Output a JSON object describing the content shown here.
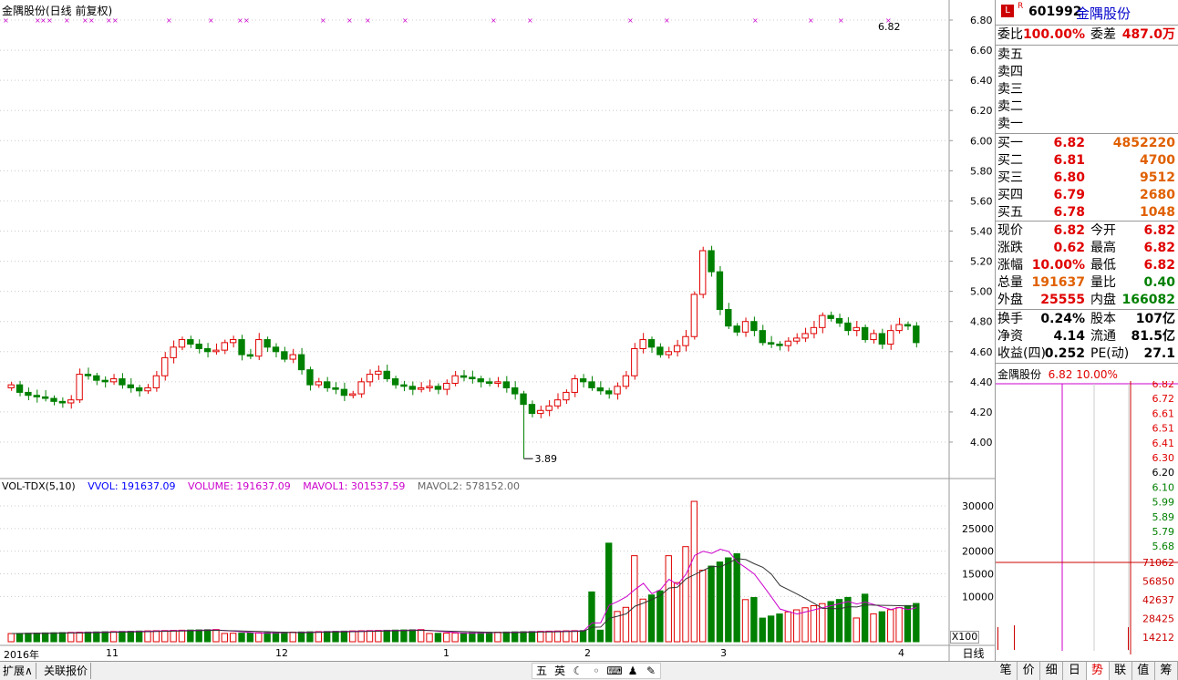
{
  "chart": {
    "title": "金隅股份(日线 前复权)",
    "last_price_label": "6.82",
    "low_label": "3.89",
    "period": "日线",
    "x100": "X100",
    "price_axis": [
      "6.80",
      "6.60",
      "6.40",
      "6.20",
      "6.00",
      "5.80",
      "5.60",
      "5.40",
      "5.20",
      "5.00",
      "4.80",
      "4.60",
      "4.40",
      "4.20",
      "4.00"
    ],
    "vol_axis": [
      "30000",
      "25000",
      "20000",
      "15000",
      "10000"
    ],
    "x_labels": [
      "2016年",
      "11",
      "12",
      "1",
      "2",
      "3",
      "4"
    ]
  },
  "volume_indicator": {
    "name": "VOL-TDX(5,10)",
    "vvol": "VVOL: 191637.09",
    "volume": "VOLUME: 191637.09",
    "mavol1": "MAVOL1: 301537.59",
    "mavol2": "MAVOL2: 578152.00"
  },
  "quote": {
    "code": "601992",
    "name": "金隅股份",
    "badge_l": "L",
    "badge_r": "R",
    "weibi_label": "委比",
    "weibi": "100.00%",
    "weicha_label": "委差",
    "weicha": "487.0万",
    "sells": [
      {
        "label": "卖五"
      },
      {
        "label": "卖四"
      },
      {
        "label": "卖三"
      },
      {
        "label": "卖二"
      },
      {
        "label": "卖一"
      }
    ],
    "buys": [
      {
        "label": "买一",
        "price": "6.82",
        "vol": "4852220"
      },
      {
        "label": "买二",
        "price": "6.81",
        "vol": "4700"
      },
      {
        "label": "买三",
        "price": "6.80",
        "vol": "9512"
      },
      {
        "label": "买四",
        "price": "6.79",
        "vol": "2680"
      },
      {
        "label": "买五",
        "price": "6.78",
        "vol": "1048"
      }
    ],
    "stats": [
      {
        "l1": "现价",
        "v1": "6.82",
        "l2": "今开",
        "v2": "6.82"
      },
      {
        "l1": "涨跌",
        "v1": "0.62",
        "l2": "最高",
        "v2": "6.82"
      },
      {
        "l1": "涨幅",
        "v1": "10.00%",
        "l2": "最低",
        "v2": "6.82"
      },
      {
        "l1": "总量",
        "v1": "191637",
        "l2": "量比",
        "v2": "0.40"
      },
      {
        "l1": "外盘",
        "v1": "25555",
        "l2": "内盘",
        "v2": "166082"
      }
    ],
    "fund": [
      {
        "l1": "换手",
        "v1": "0.24%",
        "l2": "股本",
        "v2": "107亿"
      },
      {
        "l1": "净资",
        "v1": "4.14",
        "l2": "流通",
        "v2": "81.5亿"
      },
      {
        "l1": "收益(四)",
        "v1": "0.252",
        "l2": "PE(动)",
        "v2": "27.1"
      }
    ]
  },
  "mini": {
    "name": "金隅股份",
    "price": "6.82",
    "pct": "10.00%",
    "prices": [
      "6.82",
      "6.72",
      "6.61",
      "6.51",
      "6.41",
      "6.30",
      "6.20",
      "6.10",
      "5.99",
      "5.89",
      "5.79",
      "5.68"
    ],
    "vols": [
      "71062",
      "56850",
      "42637",
      "28425",
      "14212"
    ]
  },
  "tabs": [
    "笔",
    "价",
    "细",
    "日",
    "势",
    "联",
    "值",
    "筹"
  ],
  "bottom": {
    "tab1": "扩展∧",
    "tab2": "关联报价",
    "tools": [
      "五",
      "英",
      "☾",
      "◦",
      "⌨",
      "♟",
      "✎"
    ]
  },
  "chart_data": {
    "type": "candlestick",
    "ylim": [
      3.8,
      6.9
    ],
    "last": 6.82,
    "low": 3.89
  }
}
